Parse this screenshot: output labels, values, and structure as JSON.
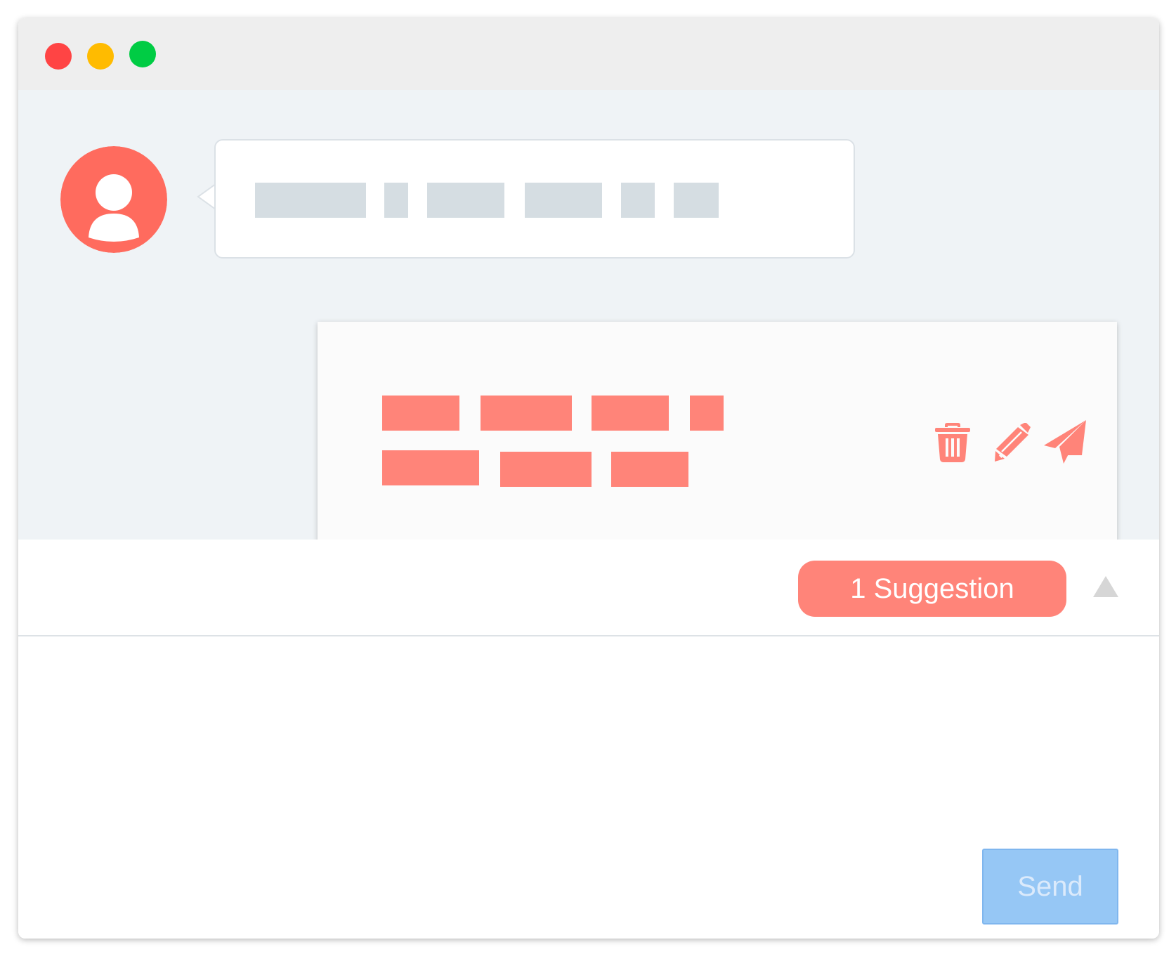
{
  "window": {
    "traffic_lights": [
      {
        "name": "close",
        "color": "#ff4444"
      },
      {
        "name": "minimize",
        "color": "#ffbb00"
      },
      {
        "name": "zoom",
        "color": "#00cc44"
      }
    ]
  },
  "colors": {
    "accent": "#ff8479",
    "avatar": "#ff6b5e",
    "placeholder_gray": "#d5dde2",
    "send_button_bg": "#96c7f5"
  },
  "incoming_message": {
    "avatar_icon": "user-avatar-icon",
    "text_placeholder_count": 6
  },
  "suggestion_card": {
    "text_placeholder_lines": 2,
    "actions": [
      {
        "name": "delete",
        "icon": "trash-icon"
      },
      {
        "name": "edit",
        "icon": "pencil-icon"
      },
      {
        "name": "send",
        "icon": "paper-plane-icon"
      }
    ]
  },
  "suggestion_bar": {
    "pill_label": "1 Suggestion",
    "toggle_icon": "triangle-up-icon"
  },
  "composer": {
    "send_label": "Send",
    "send_enabled": false
  }
}
